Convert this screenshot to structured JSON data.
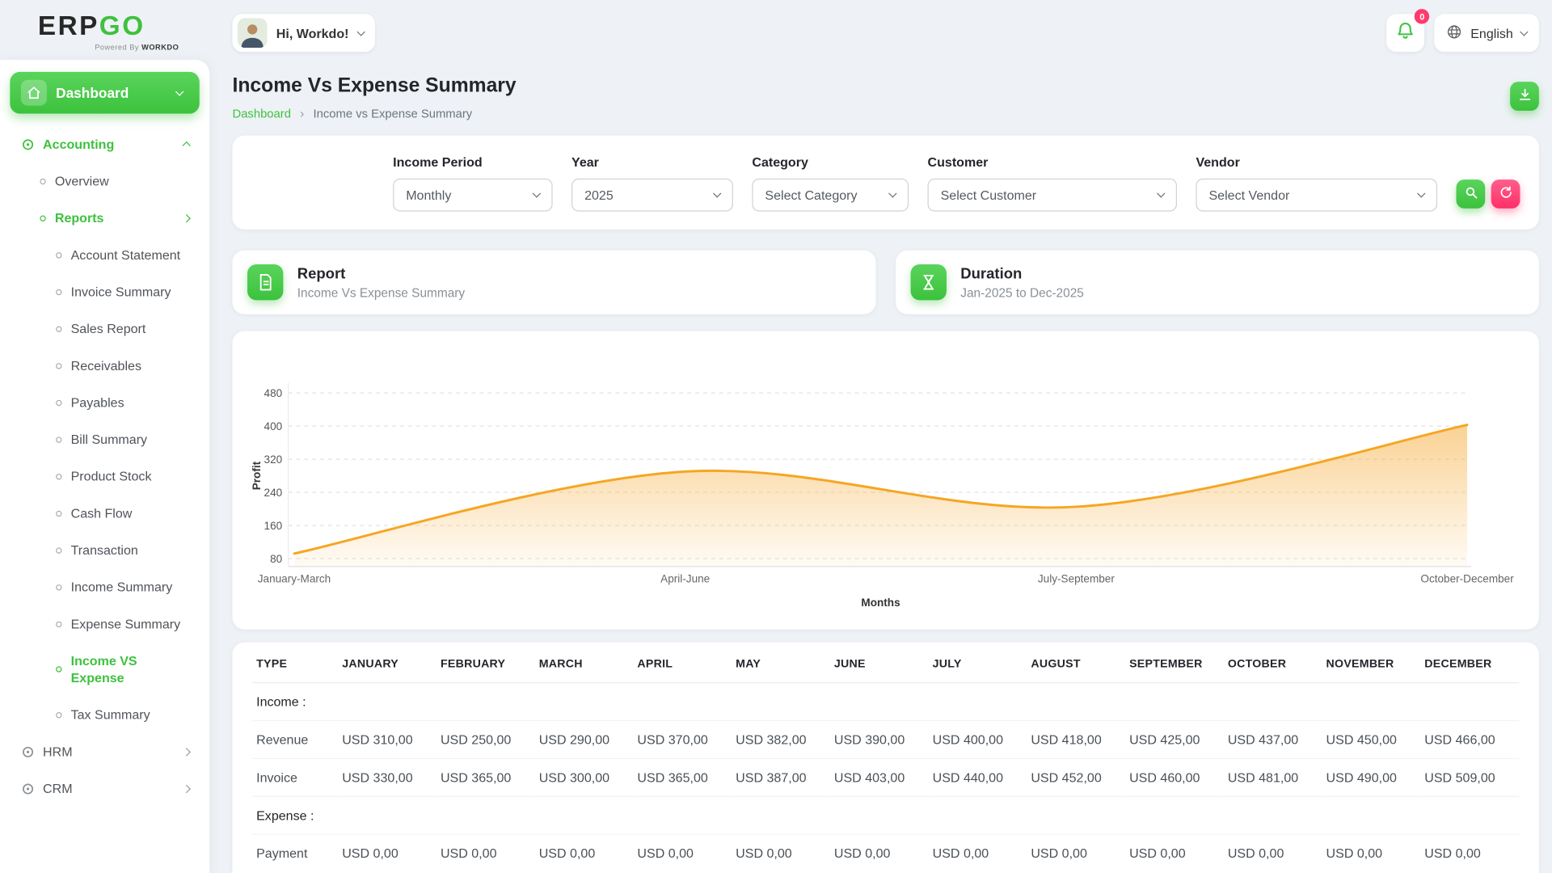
{
  "colors": {
    "accent_green": "#3ec13e",
    "pink": "#ff3a6c",
    "chart_line": "#f5a623",
    "page_background": "#eef2f6"
  },
  "brand": {
    "erp": "ERP",
    "go": "GO",
    "powered_by": "Powered By",
    "powered_name": "WORK",
    "powered_name_suffix": "DO"
  },
  "header": {
    "greeting": "Hi, Workdo!",
    "notification_count": "0",
    "language": "English"
  },
  "sidebar": {
    "dashboard": "Dashboard",
    "accounting": "Accounting",
    "overview": "Overview",
    "reports": "Reports",
    "report_items": [
      "Account Statement",
      "Invoice Summary",
      "Sales Report",
      "Receivables",
      "Payables",
      "Bill Summary",
      "Product Stock",
      "Cash Flow",
      "Transaction",
      "Income Summary",
      "Expense Summary",
      "Income VS Expense",
      "Tax Summary"
    ],
    "active_item": "Income VS Expense",
    "hrm": "HRM",
    "crm": "CRM"
  },
  "page": {
    "title": "Income Vs Expense Summary",
    "breadcrumb_home": "Dashboard",
    "breadcrumb_current": "Income vs Expense Summary"
  },
  "filters": {
    "groups": [
      {
        "label": "Income Period",
        "value": "Monthly"
      },
      {
        "label": "Year",
        "value": "2025"
      },
      {
        "label": "Category",
        "value": "Select Category"
      },
      {
        "label": "Customer",
        "value": "Select Customer"
      },
      {
        "label": "Vendor",
        "value": "Select Vendor"
      }
    ]
  },
  "cards": {
    "report": {
      "title": "Report",
      "subtitle": "Income Vs Expense Summary"
    },
    "duration": {
      "title": "Duration",
      "subtitle": "Jan-2025 to Dec-2025"
    }
  },
  "chart_data": {
    "type": "area",
    "x": [
      "January-March",
      "April-June",
      "July-September",
      "October-December"
    ],
    "series": [
      {
        "name": "Profit",
        "values": [
          92,
          290,
          205,
          403
        ]
      }
    ],
    "xlabel": "Months",
    "ylabel": "Profit",
    "yticks": [
      80,
      160,
      240,
      320,
      400,
      480
    ],
    "ylim": [
      60,
      500
    ],
    "grid": "dashed-horizontal",
    "legend": "none",
    "line_color": "#f5a623",
    "fill": "orange-gradient"
  },
  "table": {
    "columns": [
      "TYPE",
      "JANUARY",
      "FEBRUARY",
      "MARCH",
      "APRIL",
      "MAY",
      "JUNE",
      "JULY",
      "AUGUST",
      "SEPTEMBER",
      "OCTOBER",
      "NOVEMBER",
      "DECEMBER"
    ],
    "rows": [
      {
        "kind": "section",
        "label": "Income :"
      },
      {
        "kind": "data",
        "label": "Revenue",
        "values": [
          "USD 310,00",
          "USD 250,00",
          "USD 290,00",
          "USD 370,00",
          "USD 382,00",
          "USD 390,00",
          "USD 400,00",
          "USD 418,00",
          "USD 425,00",
          "USD 437,00",
          "USD 450,00",
          "USD 466,00"
        ]
      },
      {
        "kind": "data",
        "label": "Invoice",
        "values": [
          "USD 330,00",
          "USD 365,00",
          "USD 300,00",
          "USD 365,00",
          "USD 387,00",
          "USD 403,00",
          "USD 440,00",
          "USD 452,00",
          "USD 460,00",
          "USD 481,00",
          "USD 490,00",
          "USD 509,00"
        ]
      },
      {
        "kind": "section",
        "label": "Expense :"
      },
      {
        "kind": "data",
        "label": "Payment",
        "values": [
          "USD 0,00",
          "USD 0,00",
          "USD 0,00",
          "USD 0,00",
          "USD 0,00",
          "USD 0,00",
          "USD 0,00",
          "USD 0,00",
          "USD 0,00",
          "USD 0,00",
          "USD 0,00",
          "USD 0,00"
        ]
      }
    ]
  },
  "icons": [
    "home-icon",
    "chevron-down-icon",
    "chevron-up-icon",
    "chevron-right-icon",
    "bell-icon",
    "globe-icon",
    "download-icon",
    "search-icon",
    "refresh-icon",
    "document-icon",
    "hourglass-icon"
  ]
}
